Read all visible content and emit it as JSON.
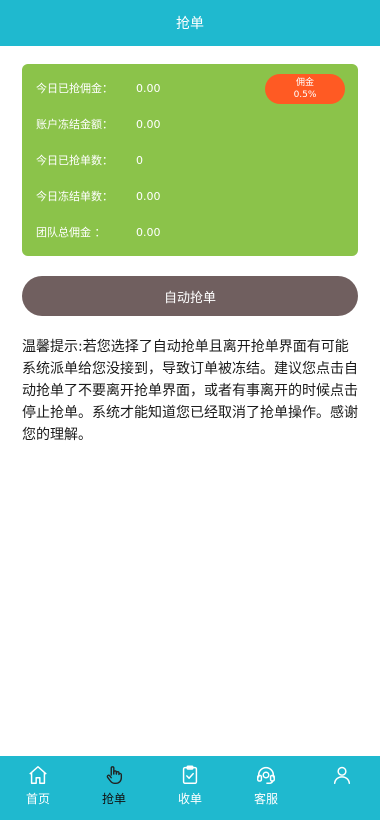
{
  "header": {
    "title": "抢单"
  },
  "stats": [
    {
      "label": "今日已抢佣金：",
      "value": "0.00"
    },
    {
      "label": "账户冻结金额：",
      "value": "0.00"
    },
    {
      "label": "今日已抢单数：",
      "value": "0"
    },
    {
      "label": "今日冻结单数：",
      "value": "0.00"
    },
    {
      "label": "团队总佣金 ：",
      "value": "0.00"
    }
  ],
  "commission": {
    "label": "佣金",
    "rate": "0.5%"
  },
  "auto_button": {
    "label": "自动抢单"
  },
  "tip": {
    "text": "温馨提示:若您选择了自动抢单且离开抢单界面有可能系统派单给您没接到，导致订单被冻结。建议您点击自动抢单了不要离开抢单界面，或者有事离开的时候点击停止抢单。系统才能知道您已经取消了抢单操作。感谢您的理解。"
  },
  "tabbar": {
    "items": [
      {
        "label": "首页",
        "icon": "home-icon",
        "active": false
      },
      {
        "label": "抢单",
        "icon": "hand-pointer-icon",
        "active": true
      },
      {
        "label": "收单",
        "icon": "clipboard-check-icon",
        "active": false
      },
      {
        "label": "客服",
        "icon": "headset-icon",
        "active": false
      },
      {
        "label": "",
        "icon": "user-icon",
        "active": false
      }
    ]
  },
  "colors": {
    "header_bg": "#1fb9cf",
    "card_bg": "#8bc34a",
    "badge_bg": "#ff5a23",
    "button_bg": "#705f5f"
  }
}
